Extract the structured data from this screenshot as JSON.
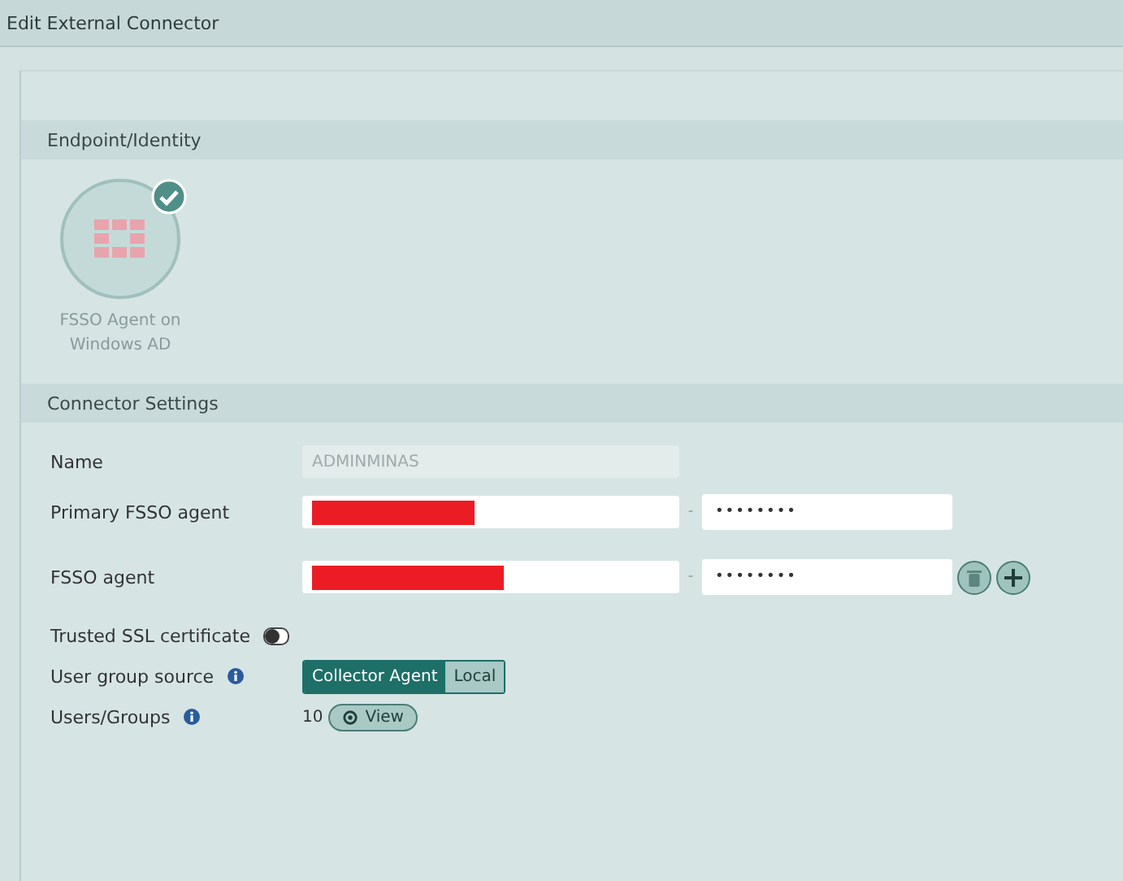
{
  "window": {
    "title": "Edit External Connector"
  },
  "endpoint_section": {
    "title": "Endpoint/Identity",
    "connector": {
      "label": "FSSO Agent on Windows AD",
      "selected": true
    }
  },
  "settings_section": {
    "title": "Connector Settings",
    "name": {
      "label": "Name",
      "value": "ADMINMINAS",
      "disabled": true
    },
    "agents": [
      {
        "label": "Primary FSSO agent",
        "address_redacted": true,
        "separator": "-",
        "password": "••••••••",
        "removable": false,
        "addable": false
      },
      {
        "label": "FSSO agent",
        "address_redacted": true,
        "separator": "-",
        "password": "••••••••",
        "removable": true,
        "addable": true
      }
    ],
    "trusted_ssl": {
      "label": "Trusted SSL certificate",
      "on": false
    },
    "user_group_source": {
      "label": "User group source",
      "options": [
        {
          "label": "Collector Agent",
          "selected": true
        },
        {
          "label": "Local",
          "selected": false
        }
      ]
    },
    "users_groups": {
      "label": "Users/Groups",
      "count": "10",
      "button": "View"
    }
  }
}
